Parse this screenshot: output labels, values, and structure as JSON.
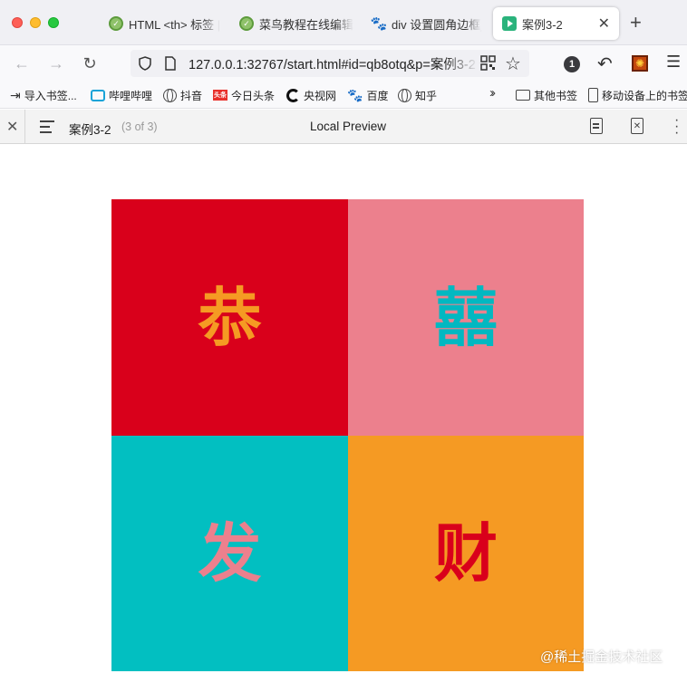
{
  "tabs": [
    {
      "title": "HTML <th> 标签 |",
      "favicon": "runoob-icon"
    },
    {
      "title": "菜鸟教程在线编辑器",
      "favicon": "runoob-icon"
    },
    {
      "title": "div 设置圆角边框_百",
      "favicon": "baidu-paw-icon"
    },
    {
      "title": "案例3-2",
      "favicon": "preview-play-icon",
      "active": true
    }
  ],
  "tab_close": "✕",
  "new_tab": "+",
  "address": {
    "url": "127.0.0.1:32767/start.html#id=qb8otq&p=案例3-2"
  },
  "toolbar": {
    "notification_count": "1"
  },
  "bookmarks": [
    {
      "label": "导入书签...",
      "icon": "import-icon"
    },
    {
      "label": "哔哩哔哩",
      "icon": "bilibili-icon"
    },
    {
      "label": "抖音",
      "icon": "globe-icon"
    },
    {
      "label": "今日头条",
      "icon": "toutiao-icon"
    },
    {
      "label": "央视网",
      "icon": "cctv-icon"
    },
    {
      "label": "百度",
      "icon": "baidu-paw-icon"
    },
    {
      "label": "知乎",
      "icon": "globe-icon"
    }
  ],
  "bookmarks_right": [
    {
      "label": "其他书签",
      "icon": "folder-icon"
    },
    {
      "label": "移动设备上的书签",
      "icon": "mobile-icon"
    }
  ],
  "preview": {
    "title": "案例3-2",
    "page_count": "(3 of 3)",
    "center_label": "Local Preview"
  },
  "grid": [
    {
      "char": "恭",
      "bg": "#d9001b",
      "color": "#f59a23"
    },
    {
      "char": "囍",
      "bg": "#ec808d",
      "color": "#02b8c1"
    },
    {
      "char": "发",
      "bg": "#02bfc1",
      "color": "#ec808d"
    },
    {
      "char": "财",
      "bg": "#f59a23",
      "color": "#d9001b"
    }
  ],
  "watermark": "@稀土掘金技术社区"
}
